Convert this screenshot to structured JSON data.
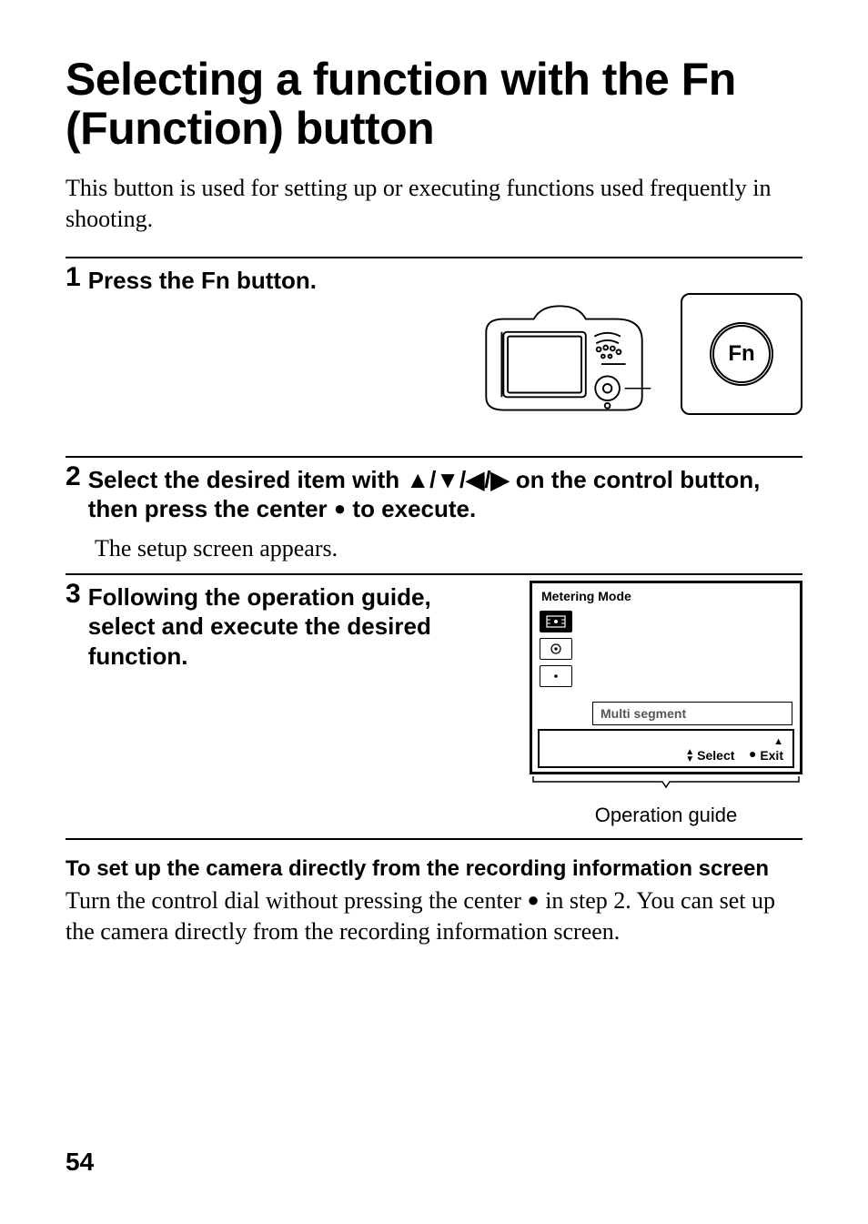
{
  "title": "Selecting a function with the Fn (Function) button",
  "intro": "This button is used for setting up or executing functions used frequently in shooting.",
  "fn_button_label": "Fn",
  "steps": {
    "s1": {
      "num": "1",
      "head": "Press the Fn button."
    },
    "s2": {
      "num": "2",
      "head_pre": "Select the desired item with ",
      "head_arrows": "▲/▼/◀/▶",
      "head_mid": " on the control button, then press the center ",
      "head_dot": "●",
      "head_post": " to execute.",
      "body": "The setup screen appears."
    },
    "s3": {
      "num": "3",
      "head": "Following the operation guide, select and execute the desired function."
    }
  },
  "screen": {
    "title": "Metering Mode",
    "selected_label": "Multi segment",
    "guide_select": "Select",
    "guide_exit": "Exit"
  },
  "operation_guide_caption": "Operation guide",
  "sub": {
    "heading": "To set up the camera directly from the recording information screen",
    "body_pre": "Turn the control dial without pressing the center ",
    "body_dot": "●",
    "body_post": " in step 2. You can set up the camera directly from the recording information screen."
  },
  "page_number": "54"
}
